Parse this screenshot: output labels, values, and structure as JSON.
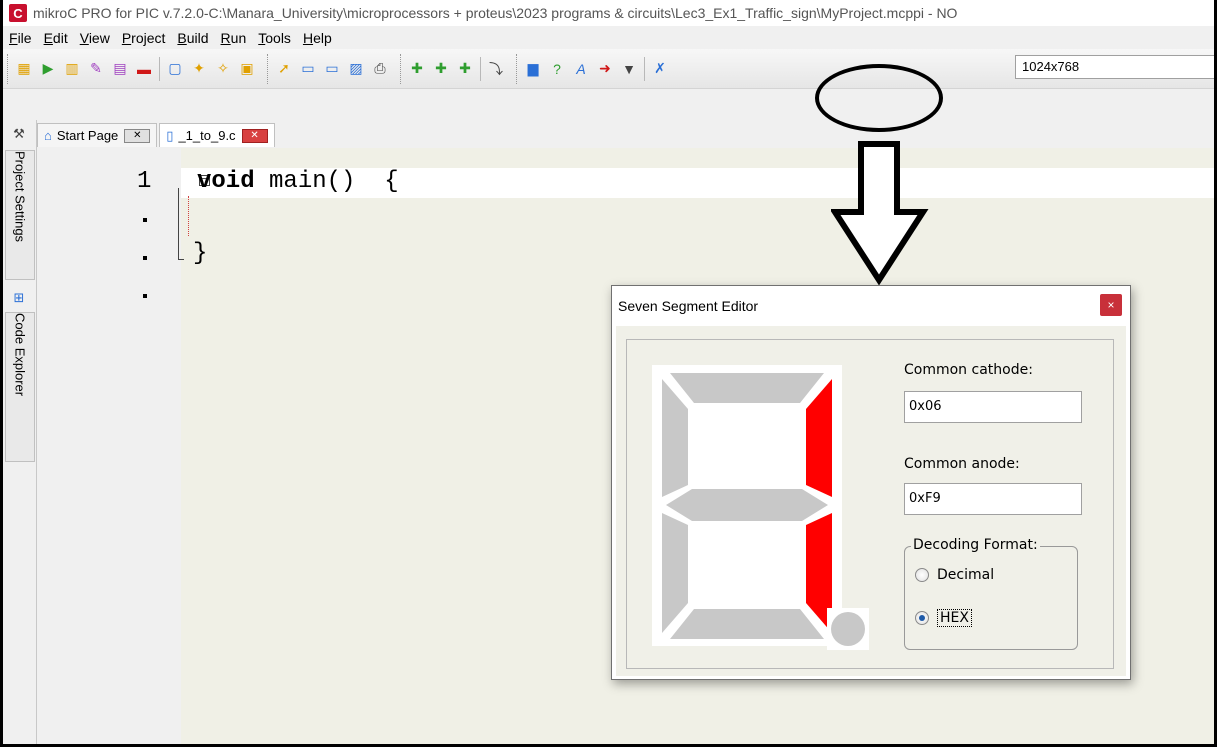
{
  "window": {
    "title": "mikroC PRO for PIC v.7.2.0-C:\\Manara_University\\microprocessors + proteus\\2023 programs & circuits\\Lec3_Ex1_Traffic_sign\\MyProject.mcppi - NO"
  },
  "menu": {
    "items": [
      {
        "label": "File",
        "accel": "F"
      },
      {
        "label": "Edit",
        "accel": "E"
      },
      {
        "label": "View",
        "accel": "V"
      },
      {
        "label": "Project",
        "accel": "P"
      },
      {
        "label": "Build",
        "accel": "B"
      },
      {
        "label": "Run",
        "accel": "R"
      },
      {
        "label": "Tools",
        "accel": "T"
      },
      {
        "label": "Help",
        "accel": "H"
      }
    ]
  },
  "toolbar": {
    "resolution": "1024x768"
  },
  "side_panel": {
    "project_settings": "Project Settings",
    "code_explorer": "Code Explorer"
  },
  "tabs": {
    "start_page": "Start Page",
    "file": "_1_to_9.c"
  },
  "editor": {
    "line_number": "1",
    "keyword": "void",
    "signature": " main()  {",
    "closing_brace": "}"
  },
  "dialog": {
    "title": "Seven Segment Editor",
    "close": "×",
    "cathode_label": "Common cathode:",
    "cathode_value": "0x06",
    "anode_label": "Common anode:",
    "anode_value": "0xF9",
    "format_label": "Decoding Format:",
    "option_decimal": "Decimal",
    "option_hex": "HEX",
    "selected_format": "HEX",
    "segments": {
      "a": false,
      "b": true,
      "c": true,
      "d": false,
      "e": false,
      "f": false,
      "g": false,
      "dp": false
    }
  },
  "colors": {
    "segment_on": "#ff0000",
    "segment_off": "#c8c8c8"
  }
}
